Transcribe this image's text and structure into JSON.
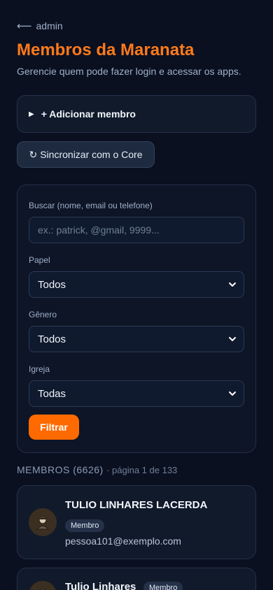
{
  "nav": {
    "back_arrow": "⟵",
    "back_label": "admin"
  },
  "header": {
    "title": "Membros da Maranata",
    "subtitle": "Gerencie quem pode fazer login e acessar os apps."
  },
  "add_member": {
    "label": "+ Adicionar membro"
  },
  "sync": {
    "icon": "↻",
    "label": "Sincronizar com o Core"
  },
  "filters": {
    "search_label": "Buscar (nome, email ou telefone)",
    "search_placeholder": "ex.: patrick, @gmail, 9999...",
    "search_value": "",
    "role_label": "Papel",
    "role_value": "Todos",
    "gender_label": "Gênero",
    "gender_value": "Todos",
    "church_label": "Igreja",
    "church_value": "Todas",
    "submit_label": "Filtrar"
  },
  "members": {
    "heading": "MEMBROS (6626)",
    "page_info": "· página 1 de 133",
    "items": [
      {
        "name": "TULIO LINHARES LACERDA",
        "role": "Membro",
        "email": "pessoa101@exemplo.com"
      },
      {
        "name": "Tulio Linhares",
        "role": "Membro",
        "email": ""
      }
    ]
  },
  "colors": {
    "accent": "#ff6a00",
    "title": "#ff7a1a",
    "background": "#0a1020"
  }
}
